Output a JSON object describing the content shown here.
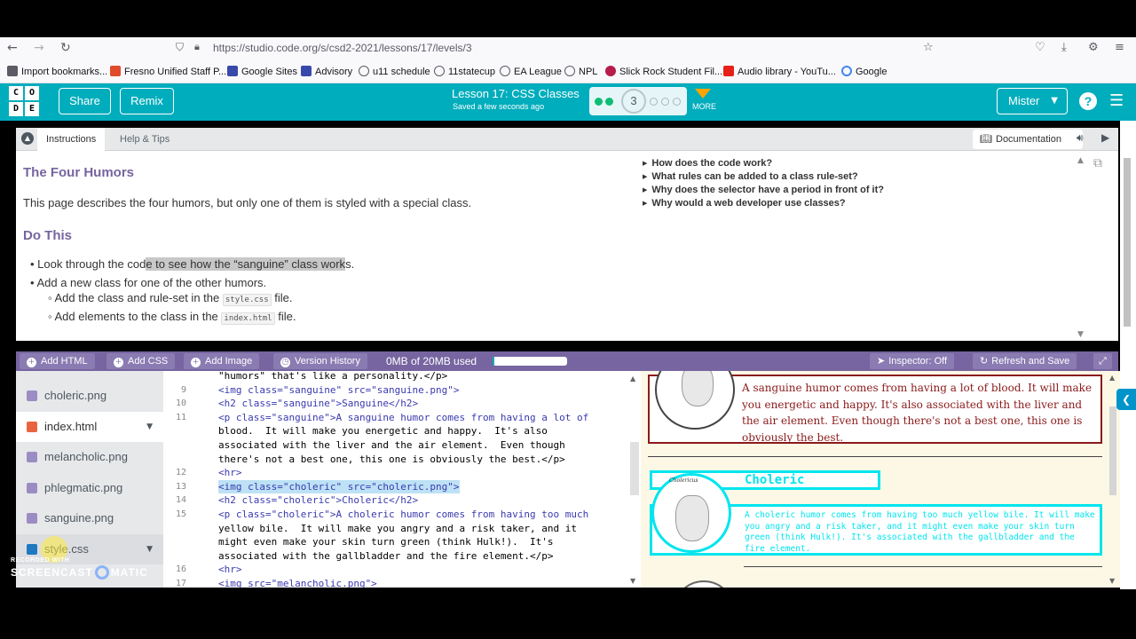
{
  "browser": {
    "url": "https://studio.code.org/s/csd2-2021/lessons/17/levels/3",
    "bookmarks": [
      {
        "label": "Import bookmarks...",
        "color": "#5b5b66"
      },
      {
        "label": "Fresno Unified Staff P...",
        "color": "#e04b2c"
      },
      {
        "label": "Google Sites",
        "color": "#3949ab"
      },
      {
        "label": "Advisory",
        "color": "#3949ab"
      },
      {
        "label": "u11 schedule",
        "color": "#5b5b66"
      },
      {
        "label": "11statecup",
        "color": "#5b5b66"
      },
      {
        "label": "EA League",
        "color": "#5b5b66"
      },
      {
        "label": "NPL",
        "color": "#5b5b66"
      },
      {
        "label": "Slick Rock Student Fil...",
        "color": "#b71c4a"
      },
      {
        "label": "Audio library - YouTu...",
        "color": "#e62117"
      },
      {
        "label": "Google",
        "color": "#4285f4"
      }
    ]
  },
  "header": {
    "logo": [
      "C",
      "O",
      "D",
      "E"
    ],
    "share": "Share",
    "remix": "Remix",
    "lesson_title": "Lesson 17: CSS Classes",
    "saved_status": "Saved a few seconds ago",
    "level_number": "3",
    "more": "MORE",
    "user": "Mister"
  },
  "instructions": {
    "tabs": [
      "Instructions",
      "Help & Tips"
    ],
    "documentation": "Documentation",
    "heading": "The Four Humors",
    "paragraph": "This page describes the four humors, but only one of them is styled with a special class.",
    "do_this": "Do This",
    "bullet1_a": "Look through the cod",
    "bullet1_b": "e to see how the “sanguine” class work",
    "bullet1_c": "s.",
    "bullet2": "Add a new class for one of the other humors.",
    "sub1_pre": "Add the class and rule-set in the ",
    "sub1_code": "style.css",
    "sub1_post": " file.",
    "sub2_pre": "Add elements to the class in the ",
    "sub2_code": "index.html",
    "sub2_post": " file.",
    "faq": [
      "How does the code work?",
      "What rules can be added to a class rule-set?",
      "Why does the selector have a period in front of it?",
      "Why would a web developer use classes?"
    ]
  },
  "workspace": {
    "buttons": [
      "Add HTML",
      "Add CSS",
      "Add Image",
      "Version History"
    ],
    "memory": "0MB of 20MB used",
    "memory_fraction": 0.02,
    "inspector": "Inspector: Off",
    "refresh": "Refresh and Save"
  },
  "files": [
    {
      "name": "choleric.png",
      "type": "image"
    },
    {
      "name": "index.html",
      "type": "html",
      "active": true
    },
    {
      "name": "melancholic.png",
      "type": "image"
    },
    {
      "name": "phlegmatic.png",
      "type": "image"
    },
    {
      "name": "sanguine.png",
      "type": "image"
    },
    {
      "name": "style.css",
      "type": "css"
    }
  ],
  "editor": {
    "lines": [
      {
        "num": "",
        "text": "\"humors\" that's like a personality.</p>"
      },
      {
        "num": "9",
        "text": "<img class=\"sanguine\" src=\"sanguine.png\">"
      },
      {
        "num": "10",
        "text": "<h2 class=\"sanguine\">Sanguine</h2>"
      },
      {
        "num": "11",
        "text": "<p class=\"sanguine\">A sanguine humor comes from having a lot of"
      },
      {
        "num": "",
        "text": "blood.  It will make you energetic and happy.  It's also"
      },
      {
        "num": "",
        "text": "associated with the liver and the air element.  Even though"
      },
      {
        "num": "",
        "text": "there's not a best one, this one is obviously the best.</p>"
      },
      {
        "num": "12",
        "text": "<hr>"
      },
      {
        "num": "13",
        "text": "<img class=\"choleric\" src=\"choleric.png\">"
      },
      {
        "num": "14",
        "text": "<h2 class=\"choleric\">Choleric</h2>"
      },
      {
        "num": "15",
        "text": "<p class=\"choleric\">A choleric humor comes from having too much"
      },
      {
        "num": "",
        "text": "yellow bile.  It will make you angry and a risk taker, and it"
      },
      {
        "num": "",
        "text": "might even make your skin turn green (think Hulk!).  It's"
      },
      {
        "num": "",
        "text": "associated with the gallbladder and the fire element.</p>"
      },
      {
        "num": "16",
        "text": "<hr>"
      },
      {
        "num": "17",
        "text": "<img src=\"melancholic.png\">"
      }
    ]
  },
  "preview": {
    "sanguine_text": "A sanguine humor comes from having a lot of blood. It will make you energetic and happy. It's also associated with the liver and the air element. Even though there's not a best one, this one is obviously the best.",
    "choleric_heading": "Choleric",
    "choleric_caption": "Cholericus",
    "choleric_text": "A choleric humor comes from having too much yellow bile. It will make you angry and a risk taker, and it might even make your skin turn green (think Hulk!). It's associated with the gallbladder and the fire element."
  },
  "watermark": {
    "line1": "RECORDED WITH",
    "line2a": "SCREENCAST",
    "line2b": "MATIC"
  },
  "colors": {
    "codeorg_teal": "#00adbc",
    "workspace_purple": "#7665a0",
    "sanguine_red": "#8b1a1a",
    "choleric_cyan": "#00e5ee"
  }
}
